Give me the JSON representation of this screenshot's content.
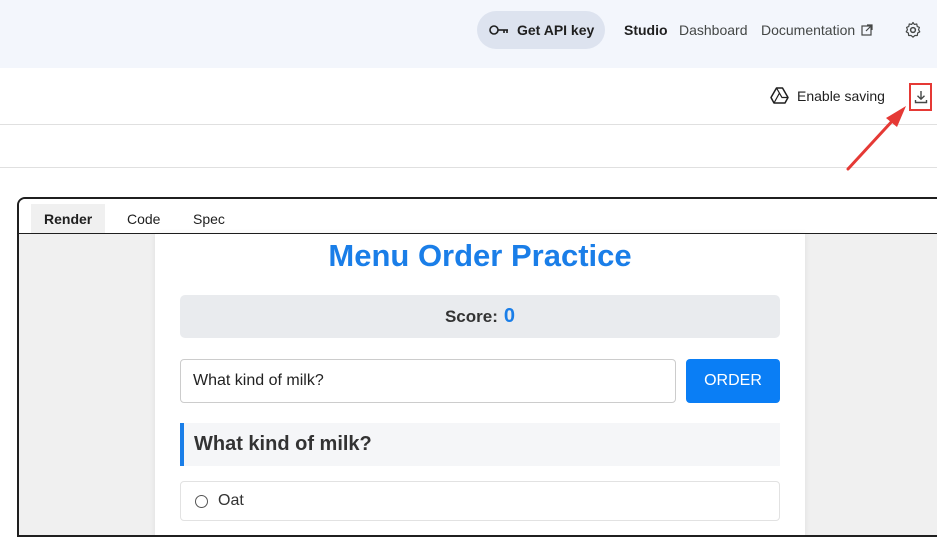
{
  "header": {
    "api_key_label": "Get API key",
    "nav": {
      "studio": "Studio",
      "dashboard": "Dashboard",
      "documentation": "Documentation"
    }
  },
  "toolbar": {
    "enable_saving_label": "Enable saving"
  },
  "panel": {
    "tabs": [
      {
        "label": "Render",
        "active": true
      },
      {
        "label": "Code",
        "active": false
      },
      {
        "label": "Spec",
        "active": false
      }
    ]
  },
  "app": {
    "title": "Menu Order Practice",
    "score_label": "Score:",
    "score_value": "0",
    "input_value": "What kind of milk?",
    "order_button": "ORDER",
    "question": "What kind of milk?",
    "options": [
      {
        "label": "Oat",
        "selected": false
      }
    ]
  },
  "colors": {
    "accent": "#1a7ee8",
    "annotation": "#e53935"
  }
}
